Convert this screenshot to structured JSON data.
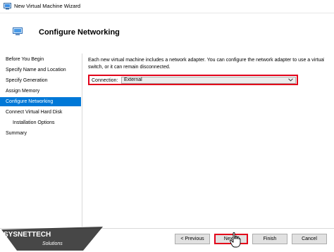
{
  "window": {
    "title": "New Virtual Machine Wizard",
    "icon": "vm-wizard-icon"
  },
  "header": {
    "title": "Configure Networking",
    "icon": "network-monitor-icon"
  },
  "sidebar": {
    "items": [
      {
        "label": "Before You Begin"
      },
      {
        "label": "Specify Name and Location"
      },
      {
        "label": "Specify Generation"
      },
      {
        "label": "Assign Memory"
      },
      {
        "label": "Configure Networking",
        "active": true
      },
      {
        "label": "Connect Virtual Hard Disk"
      },
      {
        "label": "Installation Options",
        "sub": true
      },
      {
        "label": "Summary"
      }
    ]
  },
  "main": {
    "description": "Each new virtual machine includes a network adapter. You can configure the network adapter to use a virtual switch, or it can remain disconnected.",
    "connection": {
      "label": "Connection:",
      "value": "External"
    }
  },
  "footer": {
    "previous_label": "< Previous",
    "next_label": "Next >",
    "finish_label": "Finish",
    "cancel_label": "Cancel"
  },
  "watermark": {
    "brand": "SYSNETTECH",
    "tagline": "Solutions"
  },
  "colors": {
    "accent": "#0078d7",
    "highlight": "#e2001a"
  }
}
